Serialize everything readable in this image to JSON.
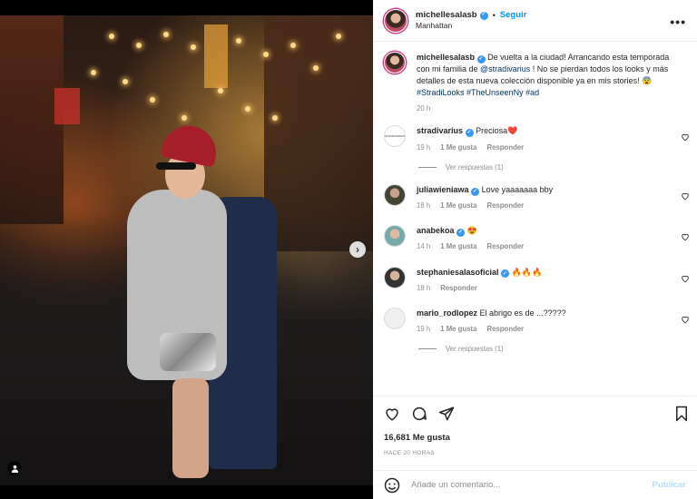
{
  "post": {
    "author": "michellesalasb",
    "follow_label": "Seguir",
    "location": "Manhattan",
    "more_label": "•••",
    "caption_prefix": "De vuelta a la ciudad! Arrancando esta temporada con mi familia de",
    "caption_mention": "@stradivarius",
    "caption_middle": " ! No se pierdan todos los looks y más detalles de esta nueva colección disponible ya en mis stories! 😨 ",
    "caption_tags": "#StradiLooks #TheUnseenNy #ad",
    "caption_time": "20 h",
    "likes": "16,681 Me gusta",
    "ago": "HACE 20 HORAS",
    "add_comment_placeholder": "Añade un comentario...",
    "publish_label": "Publicar",
    "colors": {
      "accent": "#0095f6",
      "verified": "#3897f0",
      "muted": "#8e8e8e",
      "publish_disabled": "#b2dffc"
    }
  },
  "comments": [
    {
      "user": "stradivarius",
      "avatar_text": "STRADIVARIUS",
      "verified": true,
      "text": "Preciosa❤️",
      "time": "19 h",
      "likes": "1 Me gusta",
      "reply": "Responder",
      "replies": "Ver respuestas (1)"
    },
    {
      "user": "juliawieniawa",
      "verified": true,
      "text": "Love yaaaaaaa bby",
      "time": "18 h",
      "likes": "1 Me gusta",
      "reply": "Responder"
    },
    {
      "user": "anabekoa",
      "verified": true,
      "text": "😍",
      "time": "14 h",
      "likes": "1 Me gusta",
      "reply": "Responder"
    },
    {
      "user": "stephaniesalasoficial",
      "verified": true,
      "text": "🔥🔥🔥",
      "time": "18 h",
      "reply": "Responder"
    },
    {
      "user": "mario_rodlopez",
      "verified": false,
      "text": "El abrigo es de ...?????",
      "time": "19 h",
      "likes": "1 Me gusta",
      "reply": "Responder",
      "replies": "Ver respuestas (1)"
    }
  ],
  "icons": [
    "heart-icon",
    "comment-icon",
    "share-icon",
    "bookmark-icon",
    "emoji-icon",
    "next-arrow-icon",
    "user-tag-icon",
    "verified-badge-icon",
    "more-options-icon"
  ]
}
